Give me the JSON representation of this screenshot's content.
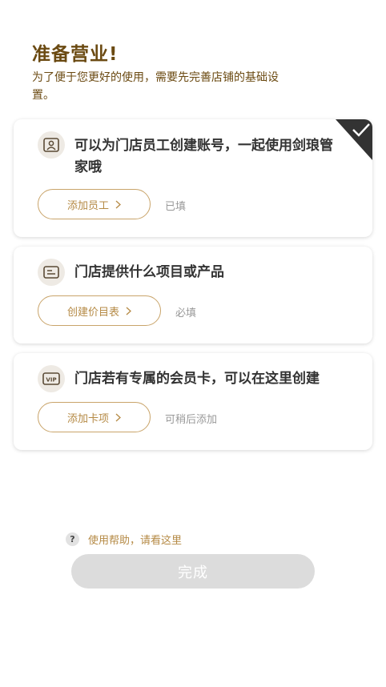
{
  "header": {
    "title": "准备营业!",
    "subtitle": "为了便于您更好的使用，需要先完善店铺的基础设置。"
  },
  "cards": [
    {
      "icon": "staff-card-icon",
      "text": "可以为门店员工创建账号，一起使用剑琅管家哦",
      "button_label": "添加员工",
      "status": "已填",
      "completed": true
    },
    {
      "icon": "price-list-icon",
      "text": "门店提供什么项目或产品",
      "button_label": "创建价目表",
      "status": "必填",
      "completed": false
    },
    {
      "icon": "vip-card-icon",
      "text": "门店若有专属的会员卡，可以在这里创建",
      "icon_text": "VIP",
      "button_label": "添加卡项",
      "status": "可稍后添加",
      "completed": false
    }
  ],
  "help": {
    "icon_text": "?",
    "label": "使用帮助，请看这里"
  },
  "footer": {
    "done_label": "完成"
  },
  "colors": {
    "title": "#6b4a12",
    "accent": "#b58a45",
    "button_border": "#c9a46a",
    "disabled_button": "#dcdcdc",
    "corner_badge": "#333333"
  }
}
